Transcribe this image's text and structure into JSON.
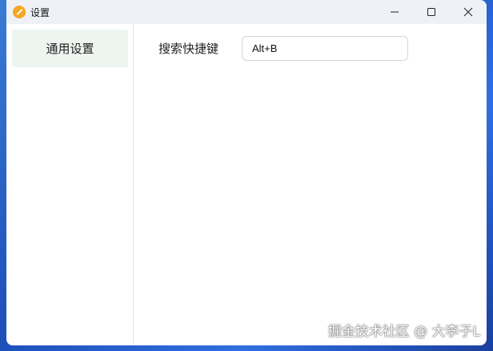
{
  "window": {
    "title": "设置"
  },
  "sidebar": {
    "items": [
      {
        "label": "通用设置",
        "selected": true
      }
    ]
  },
  "main": {
    "shortcut_label": "搜索快捷键",
    "shortcut_value": "Alt+B"
  },
  "watermark": "掘金技术社区 @ 大李子L",
  "colors": {
    "accent": "#f5a623",
    "selected_bg": "#eef4ef",
    "titlebar": "#eef1f6"
  }
}
